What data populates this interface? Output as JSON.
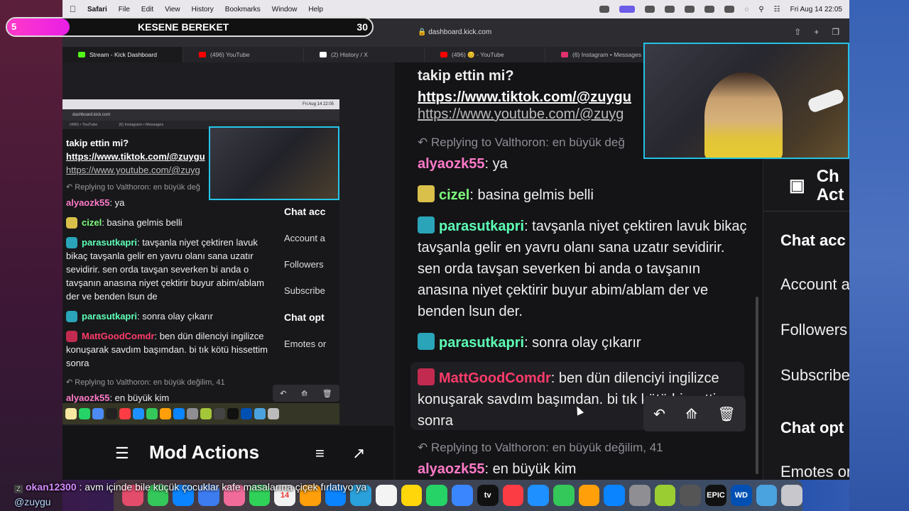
{
  "menubar": {
    "app": "Safari",
    "items": [
      "File",
      "Edit",
      "View",
      "History",
      "Bookmarks",
      "Window",
      "Help"
    ],
    "clock": "Fri Aug 14  22:05"
  },
  "overlay": {
    "badge": "5",
    "title": "KESENE BEREKET",
    "count": "30"
  },
  "browser": {
    "url": "dashboard.kick.com",
    "tabs": [
      {
        "label": "Stream - Kick Dashboard",
        "color": "#53fc18"
      },
      {
        "label": "(496) YouTube",
        "color": "#ff0000"
      },
      {
        "label": "(2) History / X",
        "color": "#ffffff"
      },
      {
        "label": "(496) 😊 - YouTube",
        "color": "#ff0000"
      },
      {
        "label": "(6) Instagram • Messages",
        "color": "#e1306c"
      }
    ]
  },
  "mini": {
    "url": "dashboard.kick.com",
    "clock": "Fri Aug 14  22:05",
    "tabs": [
      "(496) • YouTube",
      "(6) Instagram • Messages"
    ],
    "chat": [
      {
        "type": "text",
        "text": "takip ettin mi?"
      },
      {
        "type": "link",
        "text": "https://www.tiktok.com/@zuygu"
      },
      {
        "type": "link",
        "text": "https://www.youtube.com/@zuyg"
      },
      {
        "type": "reply",
        "text": "Replying to Valthoron: en büyük değ"
      },
      {
        "type": "msg",
        "user": "alyaozk55",
        "color": "#ff7ac8",
        "text": ": ya"
      },
      {
        "type": "msg",
        "user": "cizel",
        "color": "#7dff7d",
        "text": ": basina gelmis belli"
      },
      {
        "type": "msg",
        "user": "parasutkapri",
        "color": "#5dffb5",
        "text": ": tavşanla niyet çektiren lavuk bikaç tavşanla gelir en yavru olanı sana uzatır sevidirir. sen orda tavşan severken bi anda o tavşanın anasına niyet çektirir buyur abim/ablam der ve benden lsun de"
      },
      {
        "type": "msg",
        "user": "parasutkapri",
        "color": "#5dffb5",
        "text": ": sonra olay çıkarır"
      },
      {
        "type": "msg",
        "user": "MattGoodComdr",
        "color": "#ff3b6b",
        "text": ": ben dün dilenciyi ingilizce konuşarak savdım başımdan. bi tık kötü hissettim sonra"
      },
      {
        "type": "reply",
        "text": "Replying to Valthoron: en büyük değilim, 41"
      },
      {
        "type": "msg",
        "user": "alyaozk55",
        "color": "#ff7ac8",
        "text": ": en büyük kim"
      }
    ],
    "right": {
      "head": "Ch Act",
      "chat_account": "Chat acc",
      "account": "Account a",
      "followers": "Followers",
      "subscribe": "Subscribe",
      "chat_options": "Chat opt",
      "emotes": "Emotes or"
    }
  },
  "chat": {
    "top_text": "takip ettin mi?",
    "link_tiktok": "https://www.tiktok.com/@zuygu",
    "link_youtube": "https://www.youtube.com/@zuyg",
    "reply1": "Replying to Valthoron: en büyük değ",
    "m1_user": "alyaozk55",
    "m1_text": ": ya",
    "m2_user": "cizel",
    "m2_text": ": basina gelmis belli",
    "m3_user": "parasutkapri",
    "m3_text": ": tavşanla niyet çektiren lavuk bikaç tavşanla gelir en yavru olanı sana uzatır sevidirir. sen orda tavşan severken bi anda o tavşanın anasına niyet çektirir buyur abim/ablam der ve benden lsun der.",
    "m4_user": "parasutkapri",
    "m4_text": ": sonra olay çıkarır",
    "m5_user": "MattGoodComdr",
    "m5_text": ": ben dün dilenciyi ingilizce konuşarak savdım başımdan. bi tık kötü hissettim sonra",
    "reply2": "Replying to Valthoron: en büyük değilim, 41",
    "m6_user": "alyaozk55",
    "m6_text": ": en büyük kim",
    "colors": {
      "alyaozk55": "#ff7ac8",
      "cizel": "#7dff7d",
      "parasutkapri": "#5dffb5",
      "MattGoodComdr": "#ff3b6b"
    }
  },
  "rpanel": {
    "head_line1": "Ch",
    "head_line2": "Act",
    "chat_account": "Chat acc",
    "account": "Account a",
    "followers": "Followers",
    "subscribe": "Subscribe",
    "chat_options": "Chat opt",
    "emotes": "Emotes or"
  },
  "modbar": {
    "title": "Mod Actions"
  },
  "bottom_msg": {
    "user": "okan12300",
    "text": " : avm içinde bile küçük çocuklar kafe masalarına çiçek fırlatıyo ya ",
    "mention": "@zuygu"
  },
  "dock": {
    "calendar_day": "14",
    "tv_label": "tv",
    "epic_label": "EPIC",
    "wd_label": "WD"
  }
}
